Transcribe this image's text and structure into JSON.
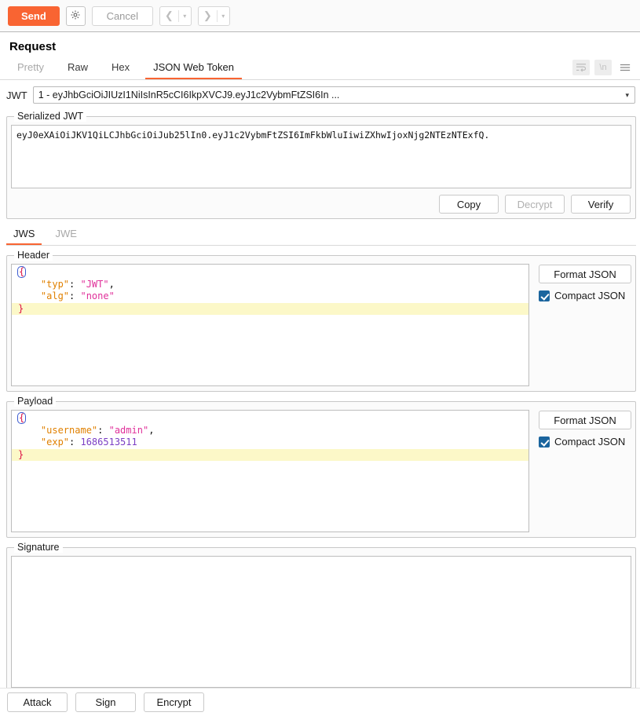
{
  "toolbar": {
    "send_label": "Send",
    "gear_icon": "gear-icon",
    "cancel_label": "Cancel",
    "prev_icon": "chevron-left-icon",
    "next_icon": "chevron-right-icon",
    "dropdown_caret": "▾"
  },
  "request": {
    "title": "Request",
    "tabs": [
      {
        "label": "Pretty",
        "active": false,
        "muted": true
      },
      {
        "label": "Raw",
        "active": false,
        "muted": false
      },
      {
        "label": "Hex",
        "active": false,
        "muted": false
      },
      {
        "label": "JSON Web Token",
        "active": true,
        "muted": false
      }
    ],
    "actions": {
      "wordwrap_icon": "word-wrap-icon",
      "newline_label": "\\n",
      "menu_icon": "hamburger-menu-icon"
    }
  },
  "jwt_selector": {
    "label": "JWT",
    "value": "1 - eyJhbGciOiJIUzI1NiIsInR5cCI6IkpXVCJ9.eyJ1c2VybmFtZSI6In ...",
    "caret": "▾"
  },
  "serialized": {
    "legend": "Serialized JWT",
    "value": "eyJ0eXAiOiJKV1QiLCJhbGciOiJub25lIn0.eyJ1c2VybmFtZSI6ImFkbWluIiwiZXhwIjoxNjg2NTEzNTExfQ.",
    "copy_label": "Copy",
    "decrypt_label": "Decrypt",
    "verify_label": "Verify"
  },
  "token_tabs": [
    {
      "label": "JWS",
      "active": true
    },
    {
      "label": "JWE",
      "active": false
    }
  ],
  "header_section": {
    "legend": "Header",
    "lines": [
      {
        "open_brace": "{",
        "highlight": false
      },
      {
        "key": "\"typ\"",
        "colon": ": ",
        "value": "\"JWT\"",
        "value_type": "string",
        "comma": ",",
        "highlight": false
      },
      {
        "key": "\"alg\"",
        "colon": ": ",
        "value": "\"none\"",
        "value_type": "string",
        "comma": "",
        "highlight": false
      },
      {
        "close_brace": "}",
        "highlight": true
      }
    ],
    "format_label": "Format JSON",
    "compact_label": "Compact JSON",
    "compact_checked": true
  },
  "payload_section": {
    "legend": "Payload",
    "lines": [
      {
        "open_brace": "{",
        "highlight": false
      },
      {
        "key": "\"username\"",
        "colon": ": ",
        "value": "\"admin\"",
        "value_type": "string",
        "comma": ",",
        "highlight": false
      },
      {
        "key": "\"exp\"",
        "colon": ": ",
        "value": "1686513511",
        "value_type": "number",
        "comma": "",
        "highlight": false
      },
      {
        "close_brace": "}",
        "highlight": true
      }
    ],
    "format_label": "Format JSON",
    "compact_label": "Compact JSON",
    "compact_checked": true
  },
  "signature_section": {
    "legend": "Signature",
    "value": ""
  },
  "bottom_actions": {
    "attack_label": "Attack",
    "sign_label": "Sign",
    "encrypt_label": "Encrypt"
  },
  "colors": {
    "accent": "#f96432",
    "checkbox": "#1b659e",
    "json_key": "#e08000",
    "json_string": "#e0309a",
    "json_number": "#7b3fc4",
    "json_brace": "#dd1144",
    "line_highlight": "#fcf8c8"
  }
}
